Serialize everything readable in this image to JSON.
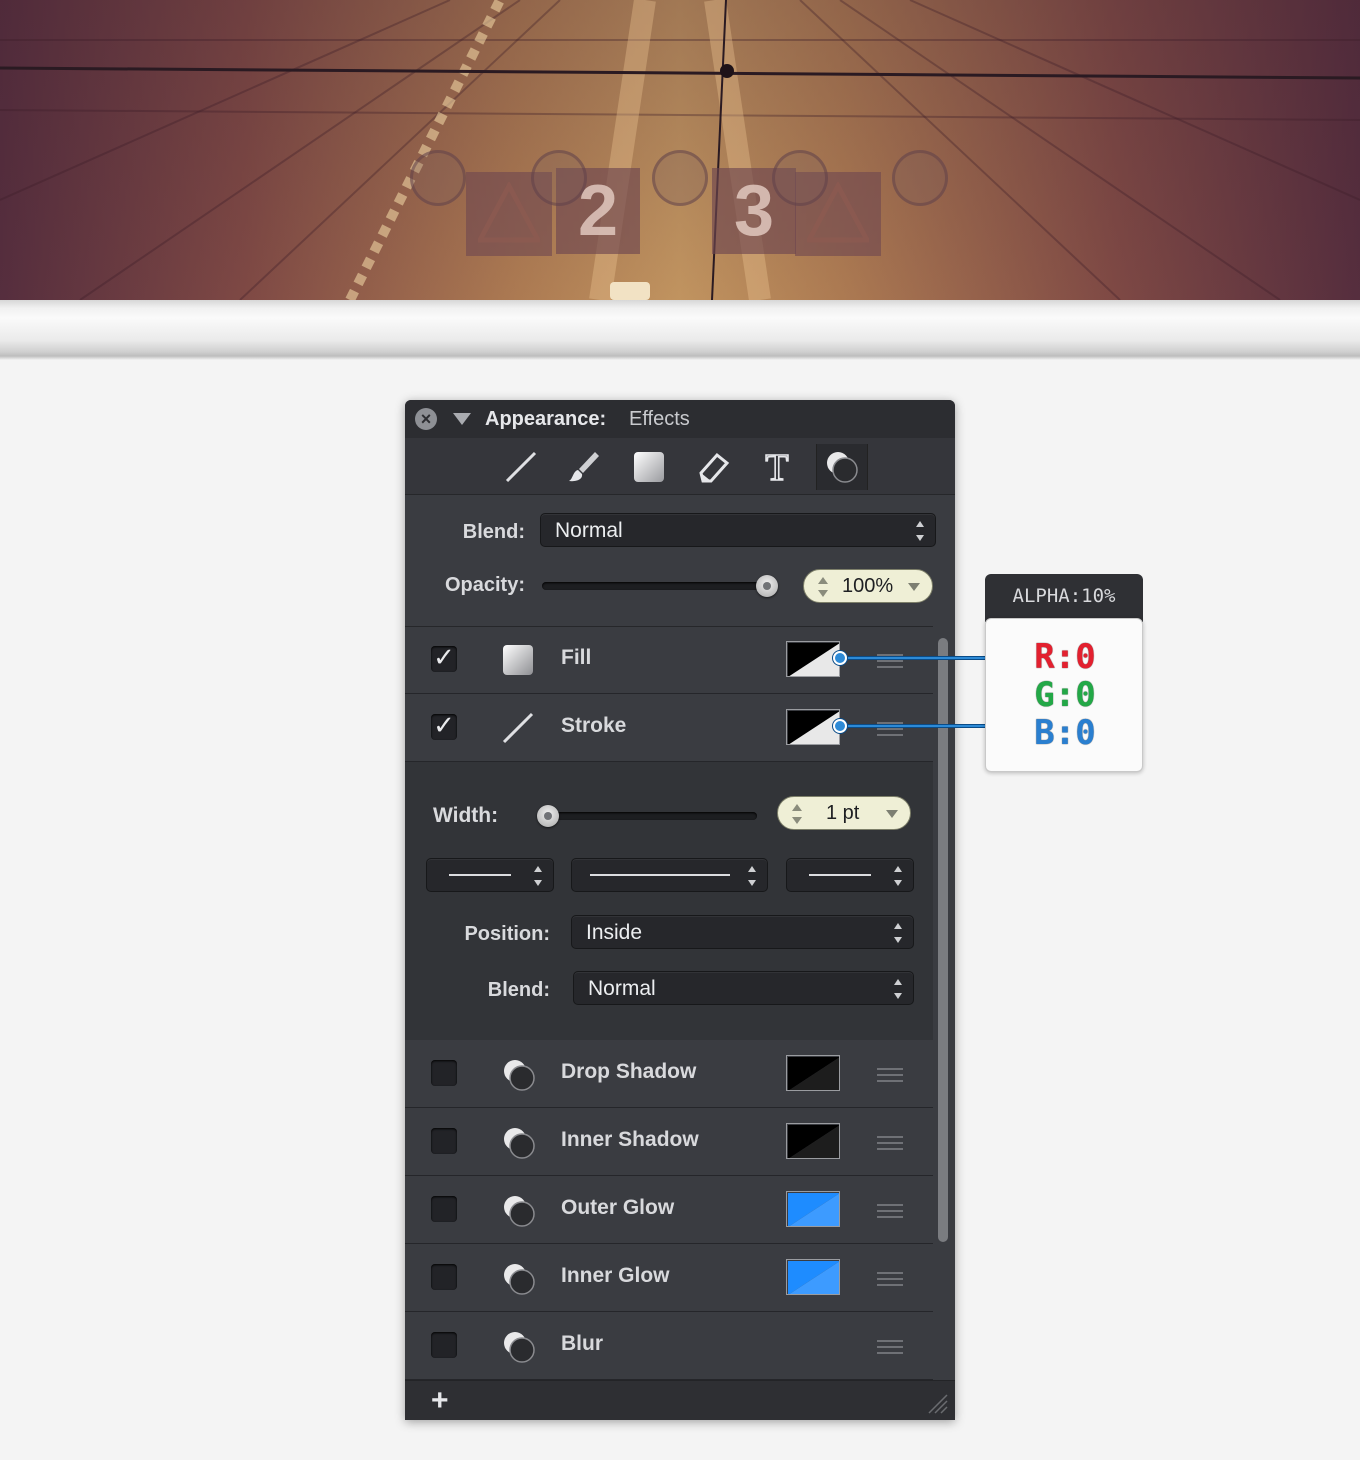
{
  "photo": {
    "numbers": [
      "2",
      "3"
    ]
  },
  "panel": {
    "title_label": "Appearance:",
    "title_value": "Effects",
    "tools": [
      "line-tool-icon",
      "brush-tool-icon",
      "shape-tool-icon",
      "eraser-tool-icon",
      "text-tool-icon",
      "effects-tool-icon"
    ],
    "blend_label": "Blend:",
    "blend_value": "Normal",
    "opacity_label": "Opacity:",
    "opacity_value": "100%",
    "opacity_level": 1.0,
    "fill": {
      "label": "Fill",
      "checked": true
    },
    "stroke": {
      "label": "Stroke",
      "checked": true
    },
    "check_glyph": "✓",
    "width_label": "Width:",
    "width_value": "1 pt",
    "width_level": 0.0,
    "position_label": "Position:",
    "position_value": "Inside",
    "stroke_blend_label": "Blend:",
    "stroke_blend_value": "Normal",
    "effects": [
      {
        "label": "Drop Shadow",
        "checked": false,
        "swatch": "#000000"
      },
      {
        "label": "Inner Shadow",
        "checked": false,
        "swatch": "#000000"
      },
      {
        "label": "Outer Glow",
        "checked": false,
        "swatch": "#1e8cff"
      },
      {
        "label": "Inner Glow",
        "checked": false,
        "swatch": "#1e8cff"
      },
      {
        "label": "Blur",
        "checked": false
      }
    ],
    "add_label": "+"
  },
  "callout": {
    "alpha": "ALPHA:10%",
    "r": "R:0",
    "g": "G:0",
    "b": "B:0",
    "colors": {
      "r": "#e3202f",
      "g": "#23a847",
      "b": "#2a7fd0"
    }
  }
}
